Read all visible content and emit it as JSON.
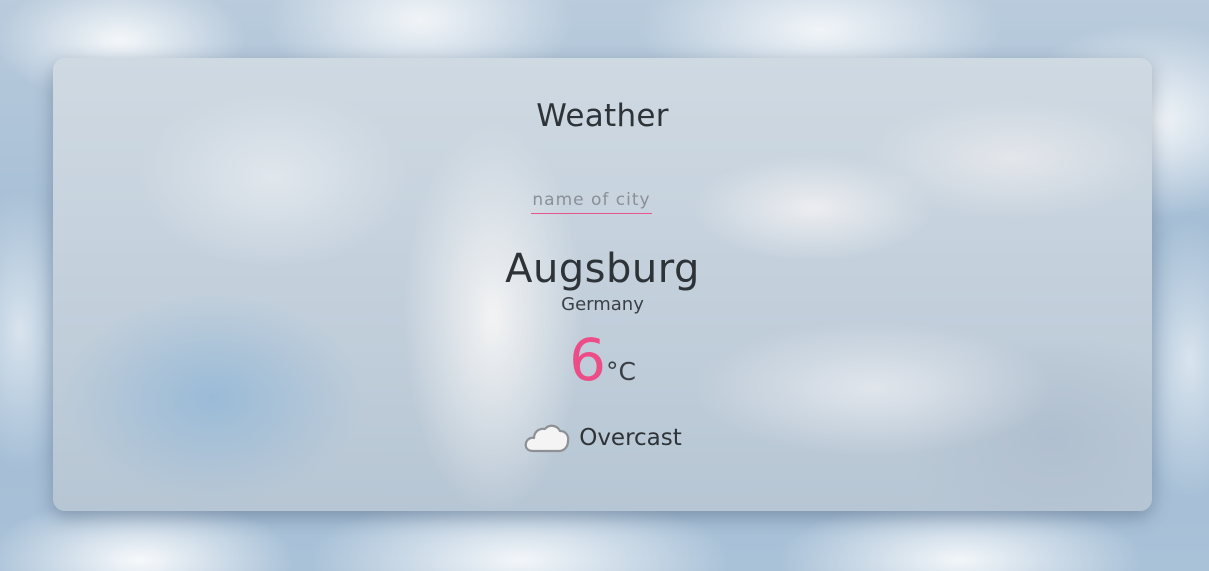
{
  "app": {
    "title": "Weather"
  },
  "search": {
    "placeholder": "name of city",
    "value": ""
  },
  "location": {
    "city": "Augsburg",
    "country": "Germany"
  },
  "temperature": {
    "value": "6",
    "unit": "°C"
  },
  "condition": {
    "label": "Overcast",
    "icon": "cloud-icon"
  },
  "colors": {
    "accent": "#ec4d86",
    "text": "#2e3338"
  }
}
